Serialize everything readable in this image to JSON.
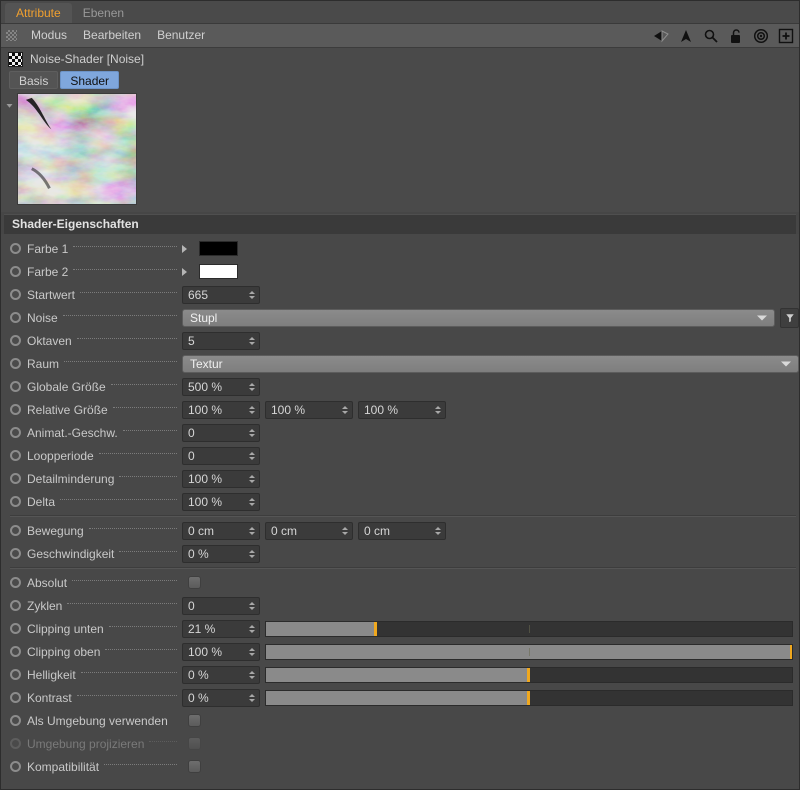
{
  "window": {
    "tabs": [
      {
        "label": "Attribute",
        "active": true
      },
      {
        "label": "Ebenen",
        "active": false
      }
    ]
  },
  "menubar": {
    "grip_icon": "grip-dots-icon",
    "items": [
      "Modus",
      "Bearbeiten",
      "Benutzer"
    ],
    "icons": [
      "back-arrow-icon",
      "up-arrow-icon",
      "search-icon",
      "lock-open-icon",
      "target-icon",
      "plus-icon"
    ]
  },
  "object_header": {
    "icon": "checkerboard-icon",
    "title": "Noise-Shader [Noise]"
  },
  "subtabs": [
    {
      "label": "Basis",
      "active": false
    },
    {
      "label": "Shader",
      "active": true
    }
  ],
  "preview": {
    "fold_icon": "triangle-down-icon",
    "alt": "noise-shader-preview"
  },
  "section": {
    "title": "Shader-Eigenschaften"
  },
  "colors": {
    "accent": "#f0a81e",
    "tab_active_text": "#f0a030",
    "subtab_active_bg": "#7fa7dd",
    "panel_bg": "#484848",
    "field_bg": "#3b3b3b",
    "slider_fill": "#8a8a8a"
  },
  "rows": [
    {
      "name": "farbe-1",
      "label": "Farbe 1",
      "type": "color",
      "value": "#000000"
    },
    {
      "name": "farbe-2",
      "label": "Farbe 2",
      "type": "color",
      "value": "#ffffff"
    },
    {
      "name": "startwert",
      "label": "Startwert",
      "type": "number",
      "value": "665"
    },
    {
      "name": "noise",
      "label": "Noise",
      "type": "combo-funnel",
      "value": "Stupl"
    },
    {
      "name": "oktaven",
      "label": "Oktaven",
      "type": "number",
      "value": "5"
    },
    {
      "name": "raum",
      "label": "Raum",
      "type": "combo",
      "value": "Textur"
    },
    {
      "name": "globale-groesse",
      "label": "Globale Größe",
      "type": "number",
      "value": "500 %"
    },
    {
      "name": "relative-groesse",
      "label": "Relative Größe",
      "type": "number3",
      "values": [
        "100 %",
        "100 %",
        "100 %"
      ]
    },
    {
      "name": "animat-geschw",
      "label": "Animat.-Geschw.",
      "type": "number",
      "value": "0"
    },
    {
      "name": "loopperiode",
      "label": "Loopperiode",
      "type": "number",
      "value": "0"
    },
    {
      "name": "detailminderung",
      "label": "Detailminderung",
      "type": "number",
      "value": "100 %"
    },
    {
      "name": "delta",
      "label": "Delta",
      "type": "number",
      "value": "100 %"
    },
    {
      "name": "group-sep-1",
      "type": "separator"
    },
    {
      "name": "bewegung",
      "label": "Bewegung",
      "type": "number3",
      "values": [
        "0 cm",
        "0 cm",
        "0 cm"
      ]
    },
    {
      "name": "geschwindigkeit",
      "label": "Geschwindigkeit",
      "type": "number",
      "value": "0 %"
    },
    {
      "name": "group-sep-2",
      "type": "separator"
    },
    {
      "name": "absolut",
      "label": "Absolut",
      "type": "checkbox",
      "checked": false
    },
    {
      "name": "zyklen",
      "label": "Zyklen",
      "type": "number",
      "value": "0"
    },
    {
      "name": "clipping-unten",
      "label": "Clipping unten",
      "type": "slider",
      "value": "21 %",
      "fill_pct": 21,
      "mid_pct": 50
    },
    {
      "name": "clipping-oben",
      "label": "Clipping oben",
      "type": "slider",
      "value": "100 %",
      "fill_pct": 100,
      "mid_pct": 50
    },
    {
      "name": "helligkeit",
      "label": "Helligkeit",
      "type": "slider",
      "value": "0 %",
      "fill_pct": 50,
      "mid_pct": 50
    },
    {
      "name": "kontrast",
      "label": "Kontrast",
      "type": "slider",
      "value": "0 %",
      "fill_pct": 50,
      "mid_pct": 50
    },
    {
      "name": "als-umgebung-verwenden",
      "label": "Als Umgebung verwenden",
      "type": "checkbox-nodots",
      "checked": false
    },
    {
      "name": "umgebung-projizieren",
      "label": "Umgebung projizieren",
      "type": "checkbox",
      "checked": false,
      "disabled": true
    },
    {
      "name": "kompatibilitaet",
      "label": "Kompatibilität",
      "type": "checkbox",
      "checked": false
    }
  ]
}
